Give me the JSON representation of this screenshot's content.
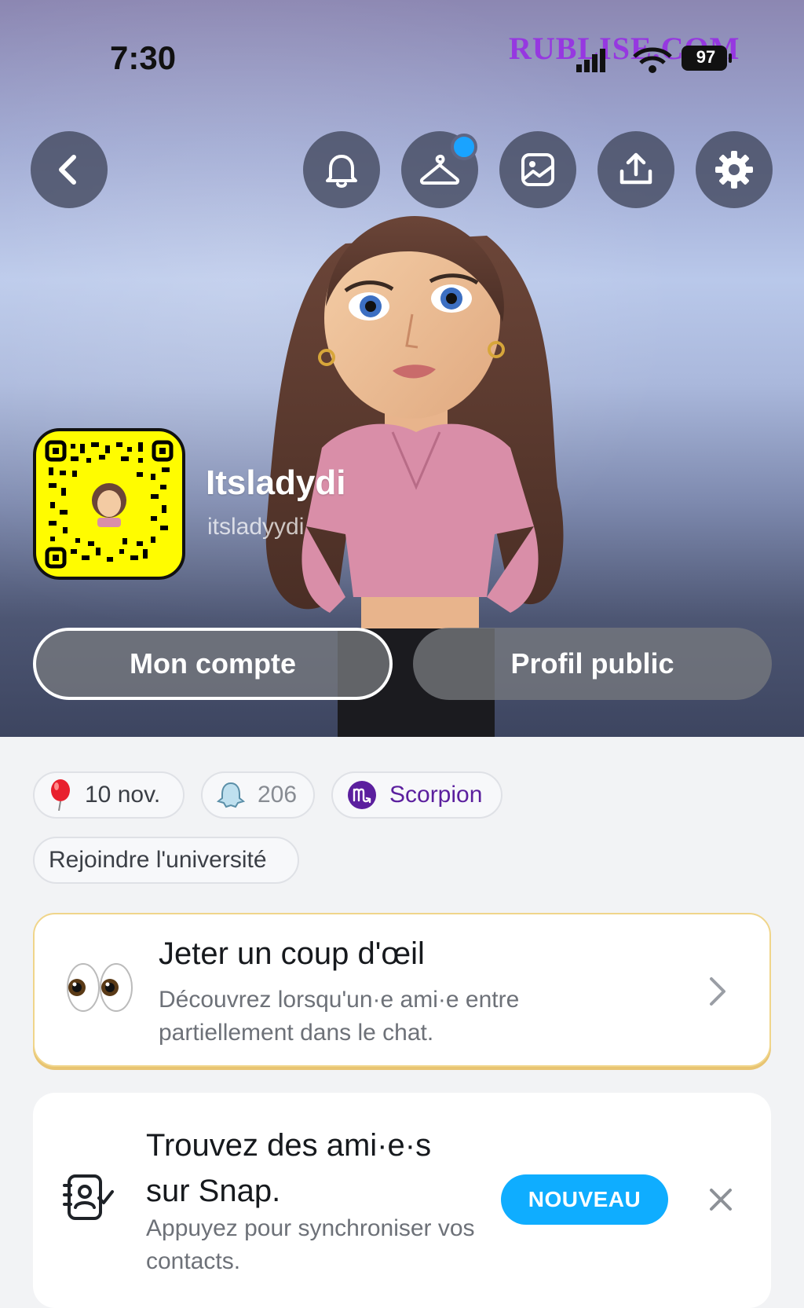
{
  "status_bar": {
    "time": "7:30",
    "battery": "97",
    "watermark": "RUBLISE.COM"
  },
  "header_buttons": {
    "back": "back-icon",
    "notifications": "bell-icon",
    "outfit": "hanger-icon",
    "memories": "image-icon",
    "share": "upload-icon",
    "settings": "gear-icon"
  },
  "profile": {
    "display_name": "Itsladydi",
    "username": "itsladyydi"
  },
  "actions": {
    "account_label": "Mon compte",
    "public_profile_label": "Profil public"
  },
  "chips": {
    "birthday": "10 nov.",
    "friends_count": "206",
    "zodiac": "Scorpion",
    "university": "Rejoindre l'université"
  },
  "peek_card": {
    "title": "Jeter un coup d'œil",
    "description": "Découvrez lorsqu'un·e ami·e entre partiellement dans le chat."
  },
  "friends_card": {
    "title": "Trouvez des ami·e·s sur Snap.",
    "description": "Appuyez pour synchroniser vos contacts.",
    "badge": "NOUVEAU"
  },
  "colors": {
    "snapcode_yellow": "#fffc00",
    "badge_blue": "#0fadff",
    "zodiac_purple": "#5b1f9e",
    "notification_dot": "#1aa3ff"
  }
}
